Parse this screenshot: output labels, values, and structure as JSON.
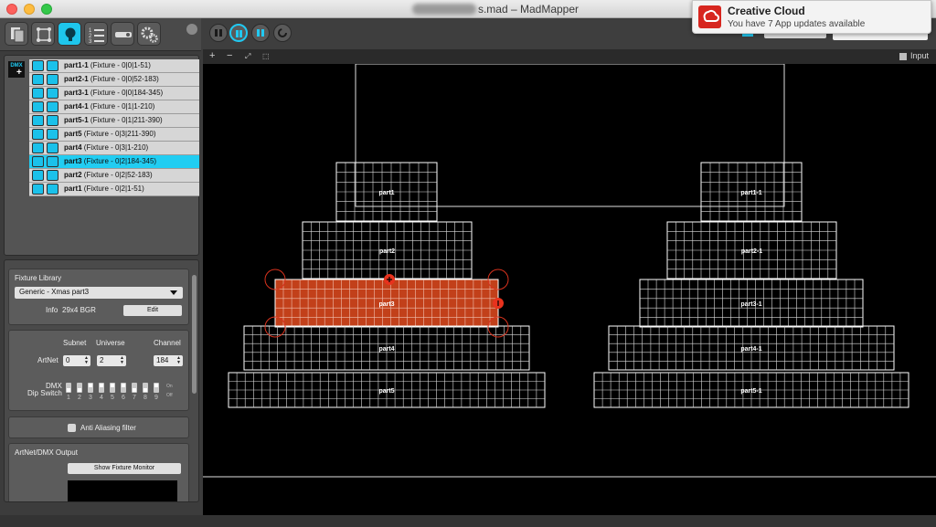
{
  "window": {
    "title_suffix": "s.mad – MadMapper"
  },
  "notification": {
    "title": "Creative Cloud",
    "body": "You have 7 App updates available"
  },
  "viewport_header": {
    "plus": "+",
    "minus": "−",
    "fit": "⤢",
    "select": "⬚",
    "input_label": "Input"
  },
  "fixtures": [
    {
      "name": "part1-1",
      "info": "(Fixture - 0|0|1-51)",
      "selected": false
    },
    {
      "name": "part2-1",
      "info": "(Fixture - 0|0|52-183)",
      "selected": false
    },
    {
      "name": "part3-1",
      "info": "(Fixture - 0|0|184-345)",
      "selected": false
    },
    {
      "name": "part4-1",
      "info": "(Fixture - 0|1|1-210)",
      "selected": false
    },
    {
      "name": "part5-1",
      "info": "(Fixture - 0|1|211-390)",
      "selected": false
    },
    {
      "name": "part5",
      "info": "(Fixture - 0|3|211-390)",
      "selected": false
    },
    {
      "name": "part4",
      "info": "(Fixture - 0|3|1-210)",
      "selected": false
    },
    {
      "name": "part3",
      "info": "(Fixture - 0|2|184-345)",
      "selected": true
    },
    {
      "name": "part2",
      "info": "(Fixture - 0|2|52-183)",
      "selected": false
    },
    {
      "name": "part1",
      "info": "(Fixture - 0|2|1-51)",
      "selected": false
    }
  ],
  "fixture_library": {
    "heading": "Fixture Library",
    "selected": "Generic - Xmas part3",
    "info_label": "Info",
    "info_value": "29x4 BGR",
    "edit_label": "Edit"
  },
  "artnet": {
    "subnet_label": "Subnet",
    "universe_label": "Universe",
    "channel_label": "Channel",
    "artnet_label": "ArtNet",
    "subnet": "0",
    "universe": "2",
    "channel": "184",
    "dmx_label": "DMX",
    "dip_label": "Dip Switch",
    "dip_numbers": [
      "1",
      "2",
      "3",
      "4",
      "5",
      "6",
      "7",
      "8",
      "9"
    ],
    "dip_on": "On",
    "dip_off": "Off"
  },
  "anti_aliasing": {
    "label": "Anti Aliasing filter"
  },
  "output": {
    "heading": "ArtNet/DMX Output",
    "monitor_button": "Show Fixture Monitor"
  },
  "canvas": {
    "labels": [
      "part1",
      "part2",
      "part3",
      "part4",
      "part5",
      "part1-1",
      "part2-1",
      "part3-1",
      "part4-1",
      "part5-1"
    ]
  },
  "colors": {
    "accent": "#21cdf2",
    "selection": "#c2401a",
    "handle": "#e8321d"
  }
}
